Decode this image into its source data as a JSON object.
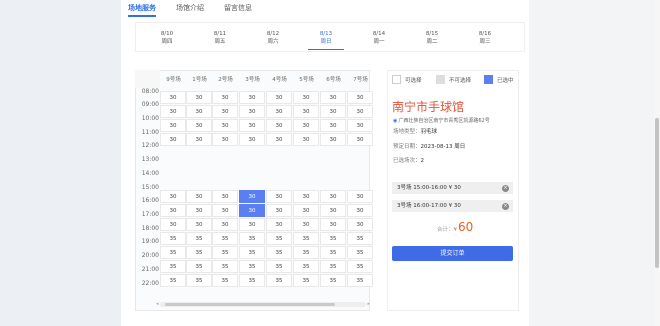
{
  "tabs": [
    "场地服务",
    "场馆介绍",
    "留言信息"
  ],
  "dates": [
    {
      "date": "8/10",
      "weekday": "周四"
    },
    {
      "date": "8/11",
      "weekday": "周五"
    },
    {
      "date": "8/12",
      "weekday": "周六"
    },
    {
      "date": "8/13",
      "weekday": "周日"
    },
    {
      "date": "8/14",
      "weekday": "周一"
    },
    {
      "date": "8/15",
      "weekday": "周二"
    },
    {
      "date": "8/16",
      "weekday": "周三"
    }
  ],
  "courts": [
    "9号场",
    "1号场",
    "2号场",
    "3号场",
    "4号场",
    "5号场",
    "6号场",
    "7号场"
  ],
  "times": [
    "08:00",
    "09:00",
    "10:00",
    "11:00",
    "12:00",
    "13:00",
    "14:00",
    "15:00",
    "16:00",
    "17:00",
    "18:00",
    "19:00",
    "20:00",
    "21:00",
    "22:00"
  ],
  "grid_values": {
    "price_30": "30",
    "price_35": "35"
  },
  "legend": {
    "available": "可选择",
    "unavailable": "不可选择",
    "selected": "已选中"
  },
  "venue": {
    "name": "南宁市手球馆",
    "address": "广西壮族自治区南宁市青秀区凯源路62号",
    "type_label": "场地类型：",
    "type_value": "羽毛球",
    "date_label": "预定日期：",
    "date_value": "2023-08-13 周日",
    "count_label": "已选场次：",
    "count_value": "2"
  },
  "order_items": [
    "3号场 15:00-16:00 ¥ 30",
    "3号场 16:00-17:00 ¥ 30"
  ],
  "total": {
    "label": "合计：",
    "currency": "¥",
    "amount": "60"
  },
  "submit_label": "提交订单",
  "colors": {
    "accent": "#2f6fe8",
    "selected_cell": "#5b7ff0",
    "price": "#f25c1a",
    "venue_name": "#e2533a"
  }
}
